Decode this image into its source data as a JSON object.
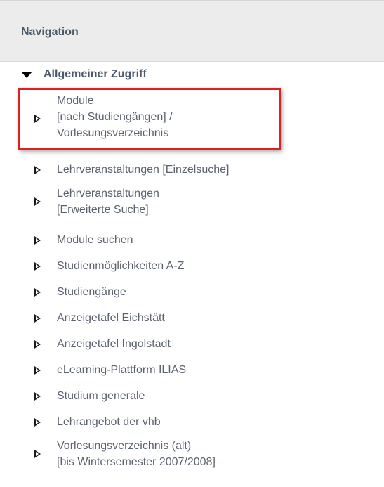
{
  "navigation": {
    "title": "Navigation"
  },
  "section": {
    "label": "Allgemeiner Zugriff",
    "state": "expanded"
  },
  "items": [
    {
      "label": "Module\n[nach Studiengängen] /\nVorlesungsverzeichnis",
      "highlighted": true
    },
    {
      "label": "Lehrveranstaltungen [Einzelsuche]"
    },
    {
      "label": "Lehrveranstaltungen\n[Erweiterte Suche]"
    },
    {
      "label": "Module suchen"
    },
    {
      "label": "Studienmöglichkeiten A-Z"
    },
    {
      "label": "Studiengänge"
    },
    {
      "label": "Anzeigetafel Eichstätt"
    },
    {
      "label": "Anzeigetafel Ingolstadt"
    },
    {
      "label": "eLearning-Plattform ILIAS"
    },
    {
      "label": "Studium generale"
    },
    {
      "label": "Lehrangebot der vhb"
    },
    {
      "label": "Vorlesungsverzeichnis (alt)\n[bis Wintersemester 2007/2008]"
    }
  ],
  "colors": {
    "header_bg": "#ececec",
    "heading_text": "#4b5a6b",
    "item_text": "#5c6370",
    "highlight": "#e0201f"
  },
  "icons": {
    "section": "triangle-down-icon",
    "item": "triangle-right-outline-icon"
  }
}
